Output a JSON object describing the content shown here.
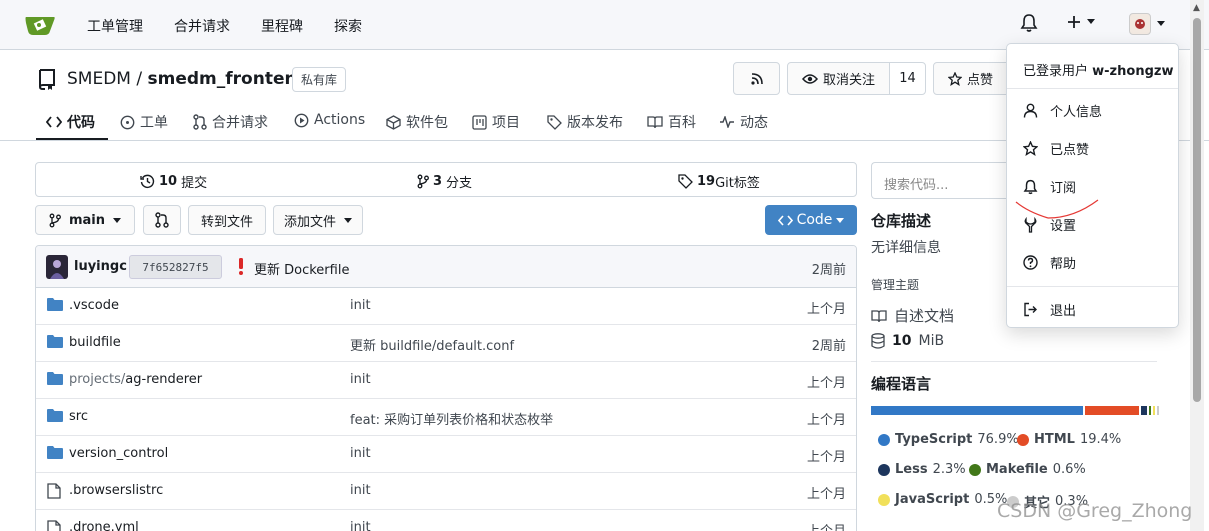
{
  "topnav": {
    "items": [
      "工单管理",
      "合并请求",
      "里程碑",
      "探索"
    ]
  },
  "repo": {
    "owner": "SMEDM",
    "separator": "/",
    "name": "smedm_frontend",
    "private_badge": "私有库",
    "unwatch_label": "取消关注",
    "watch_count": "14",
    "star_label": "点赞"
  },
  "tabs": [
    "代码",
    "工单",
    "合并请求",
    "Actions",
    "软件包",
    "项目",
    "版本发布",
    "百科",
    "动态"
  ],
  "stats": {
    "commits_num": "10",
    "commits_label": "提交",
    "branches_num": "3",
    "branches_label": "分支",
    "tags_num": "19",
    "tags_label": "Git标签"
  },
  "branch_bar": {
    "branch": "main",
    "goto_file": "转到文件",
    "add_file": "添加文件",
    "code_label": "Code"
  },
  "latest_commit": {
    "author": "luyingc",
    "sha": "7f652827f5",
    "message": "更新 Dockerfile",
    "time": "2周前"
  },
  "files": [
    {
      "type": "dir",
      "prefix": "",
      "name": ".vscode",
      "message": "init",
      "time": "上个月"
    },
    {
      "type": "dir",
      "prefix": "",
      "name": "buildfile",
      "message": "更新 buildfile/default.conf",
      "time": "2周前"
    },
    {
      "type": "dir",
      "prefix": "projects/",
      "name": "ag-renderer",
      "message": "init",
      "time": "上个月"
    },
    {
      "type": "dir",
      "prefix": "",
      "name": "src",
      "message": "feat: 采购订单列表价格和状态枚举",
      "time": "上个月"
    },
    {
      "type": "dir",
      "prefix": "",
      "name": "version_control",
      "message": "init",
      "time": "上个月"
    },
    {
      "type": "file",
      "prefix": "",
      "name": ".browserslistrc",
      "message": "init",
      "time": "上个月"
    },
    {
      "type": "file",
      "prefix": "",
      "name": ".drone.yml",
      "message": "init",
      "time": "上个月"
    }
  ],
  "sidebar": {
    "search_placeholder": "搜索代码...",
    "desc_title": "仓库描述",
    "desc_text": "无详细信息",
    "topics_label": "管理主题",
    "readme": "自述文档",
    "size_num": "10",
    "size_unit": "MiB",
    "lang_title": "编程语言"
  },
  "languages": [
    {
      "name": "TypeScript",
      "percent": "76.9%",
      "value": 76.9,
      "color": "#3178c6"
    },
    {
      "name": "HTML",
      "percent": "19.4%",
      "value": 19.4,
      "color": "#e34c26"
    },
    {
      "name": "Less",
      "percent": "2.3%",
      "value": 2.3,
      "color": "#1d365d"
    },
    {
      "name": "Makefile",
      "percent": "0.6%",
      "value": 0.6,
      "color": "#427819"
    },
    {
      "name": "JavaScript",
      "percent": "0.5%",
      "value": 0.5,
      "color": "#f1e05a"
    },
    {
      "name": "其它",
      "percent": "0.3%",
      "value": 0.3,
      "color": "#cccccc"
    }
  ],
  "user_menu": {
    "signed_in_as": "已登录用户",
    "username": "w-zhongzw",
    "items": [
      "个人信息",
      "已点赞",
      "订阅",
      "设置",
      "帮助"
    ],
    "logout": "退出"
  },
  "watermark": "CSDN @Greg_Zhong",
  "colors": {
    "primary": "#4183c4",
    "folder": "#4183c4"
  }
}
